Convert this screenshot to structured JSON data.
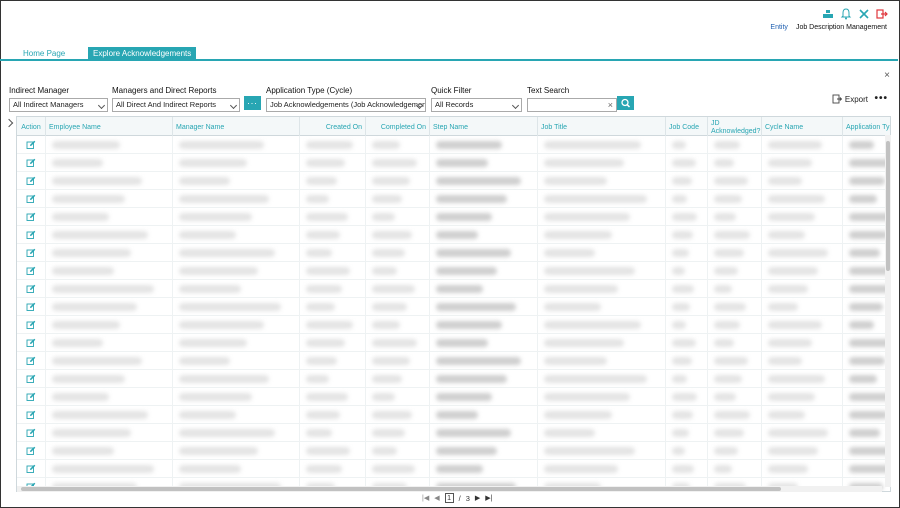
{
  "header": {
    "entity_link": "Entity",
    "module_title": "Job Description Management",
    "icons": [
      "org-chart-icon",
      "bell-icon",
      "tools-icon",
      "logout-icon"
    ]
  },
  "tabs": [
    {
      "label": "Home Page",
      "active": false
    },
    {
      "label": "Explore Acknowledgements",
      "active": true
    }
  ],
  "filters": {
    "indirect_manager": {
      "label": "Indirect Manager",
      "value": "All Indirect Managers"
    },
    "managers_direct_reports": {
      "label": "Managers and Direct Reports",
      "value": "All Direct And Indirect Reports",
      "more": "..."
    },
    "application_type": {
      "label": "Application Type (Cycle)",
      "value": "Job Acknowledgements (Job Acknowledgements)"
    },
    "quick_filter": {
      "label": "Quick Filter",
      "value": "All Records"
    },
    "text_search": {
      "label": "Text Search",
      "value": "",
      "placeholder": "",
      "clear": "×"
    }
  },
  "toolbar": {
    "export_label": "Export",
    "more": "•••",
    "close": "×"
  },
  "grid": {
    "columns": [
      "Action",
      "Employee Name",
      "Manager Name",
      "Created On",
      "Completed On",
      "Step Name",
      "Job Title",
      "Job Code",
      "JD Acknowledged?",
      "Cycle Name",
      "Application Type"
    ],
    "visible_rows": 20
  },
  "pager": {
    "current_page": "1",
    "separator": "/",
    "total_pages": "3"
  },
  "colors": {
    "accent": "#28a6b3",
    "link": "#1e5fb0"
  }
}
